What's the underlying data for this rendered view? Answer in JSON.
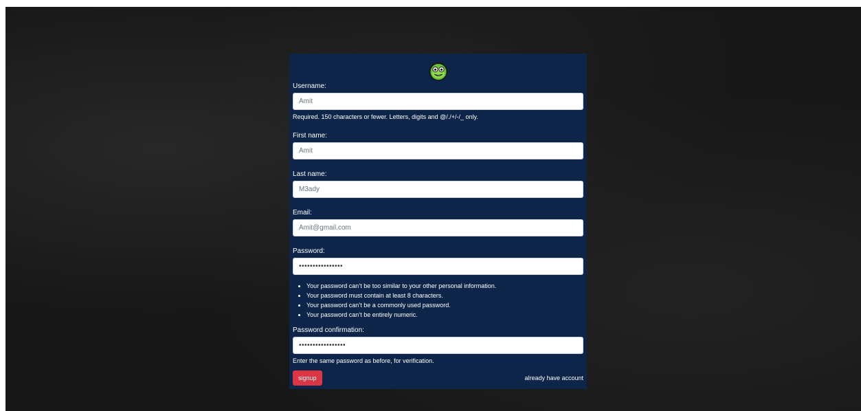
{
  "form": {
    "username": {
      "label": "Username:",
      "value": "Amit",
      "help": "Required. 150 characters or fewer. Letters, digits and @/./+/-/_ only."
    },
    "first_name": {
      "label": "First name:",
      "value": "Amit"
    },
    "last_name": {
      "label": "Last name:",
      "value": "M3ady"
    },
    "email": {
      "label": "Email:",
      "value": "Amit@gmail.com"
    },
    "password": {
      "label": "Password:",
      "value": "••••••••••••••••",
      "rules": [
        "Your password can’t be too similar to your other personal information.",
        "Your password must contain at least 8 characters.",
        "Your password can’t be a commonly used password.",
        "Your password can’t be entirely numeric."
      ]
    },
    "password_confirmation": {
      "label": "Password confirmation:",
      "value": "•••••••••••••••••",
      "help": "Enter the same password as before, for verification."
    },
    "signup_label": "signup",
    "login_link": "already have account"
  },
  "colors": {
    "card_bg": "#0c2548",
    "button_bg": "#dc3545",
    "page_bg": "#171717"
  },
  "logo": {
    "icon": "frog-face-icon"
  }
}
